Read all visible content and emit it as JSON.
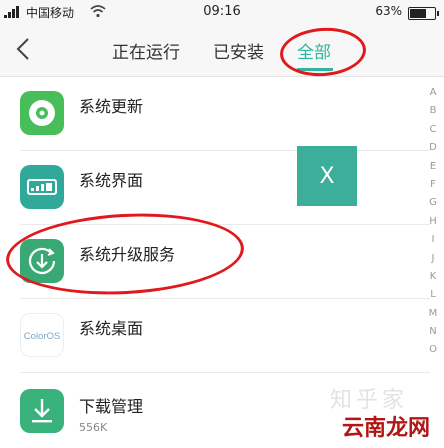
{
  "status_bar": {
    "carrier": "中国移动",
    "time": "09:16",
    "battery_text": "63%",
    "battery_level": 0.63
  },
  "nav": {
    "back_icon": "back-arrow-icon",
    "tabs": [
      {
        "label": "正在运行"
      },
      {
        "label": "已安装"
      },
      {
        "label": "全部"
      }
    ],
    "active_tab": "全部",
    "accent_color": "#2fb4a0"
  },
  "apps": [
    {
      "name": "系统更新",
      "icon": "disc-icon",
      "color": "#47be59"
    },
    {
      "name": "系统界面",
      "icon": "battery-ui-icon",
      "color": "#31a99a"
    },
    {
      "name": "系统升级服务",
      "icon": "download-circle-icon",
      "color": "#3aa875"
    },
    {
      "name": "系统桌面",
      "icon": "coloros-logo-icon",
      "color": "#ffffff"
    },
    {
      "name": "下载管理",
      "size": "556K",
      "icon": "download-tray-icon",
      "color": "#38b27a"
    }
  ],
  "alphabet": [
    "A",
    "B",
    "C",
    "D",
    "E",
    "F",
    "G",
    "H",
    "I",
    "J",
    "K",
    "L",
    "M",
    "N",
    "O"
  ],
  "overlay_button": {
    "label": "X"
  },
  "watermark": {
    "text": "云南龙网",
    "faint_text": "知乎家"
  },
  "logo_text": "ColorOS"
}
